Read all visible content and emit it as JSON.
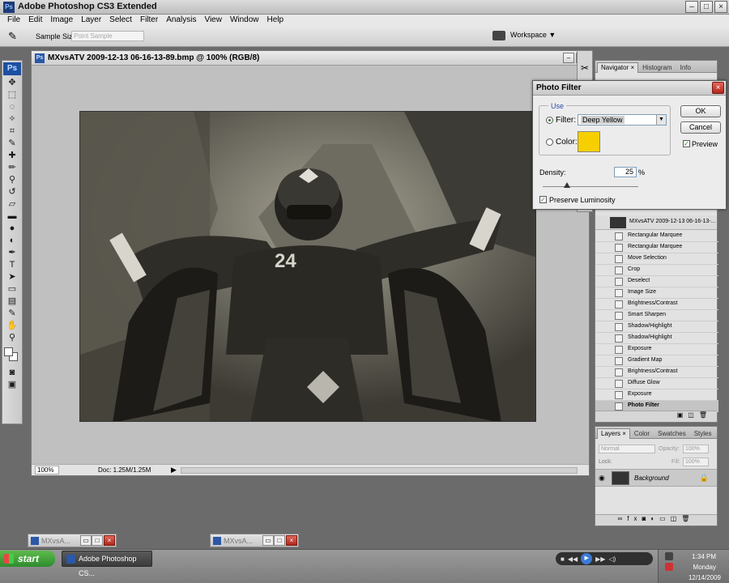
{
  "app": {
    "title": "Adobe Photoshop CS3 Extended",
    "logo": "Ps"
  },
  "menu": [
    "File",
    "Edit",
    "Image",
    "Layer",
    "Select",
    "Filter",
    "Analysis",
    "View",
    "Window",
    "Help"
  ],
  "options": {
    "sample_size_label": "Sample Size:",
    "sample_size_value": "Point Sample",
    "workspace_label": "Workspace ▼"
  },
  "document": {
    "title": "MXvsATV 2009-12-13 06-16-13-89.bmp @ 100% (RGB/8)",
    "zoom": "100%",
    "doc_info": "Doc: 1.25M/1.25M"
  },
  "dialog": {
    "title": "Photo Filter",
    "use_label": "Use",
    "filter_label": "Filter:",
    "filter_value": "Deep Yellow",
    "color_label": "Color:",
    "swatch_color": "#f7cf00",
    "ok": "OK",
    "cancel": "Cancel",
    "preview": "Preview",
    "density_label": "Density:",
    "density_value": "25",
    "density_unit": "%",
    "density_fraction": 0.25,
    "preserve": "Preserve Luminosity"
  },
  "top_panel": {
    "tabs": [
      "Navigator ×",
      "Histogram",
      "Info"
    ]
  },
  "history": {
    "snapshot": "MXvsATV 2009-12-13 06-16-13-...",
    "items": [
      "Rectangular Marquee",
      "Rectangular Marquee",
      "Move Selection",
      "Crop",
      "Deselect",
      "Image Size",
      "Brightness/Contrast",
      "Smart Sharpen",
      "Shadow/Highlight",
      "Shadow/Highlight",
      "Exposure",
      "Gradient Map",
      "Brightness/Contrast",
      "Diffuse Glow",
      "Exposure",
      "Photo Filter"
    ]
  },
  "layers": {
    "tabs": [
      "Layers ×",
      "Color",
      "Swatches",
      "Styles"
    ],
    "mode": "Normal",
    "opacity_label": "Opacity:",
    "opacity": "100%",
    "lock_label": "Lock:",
    "fill_label": "Fill:",
    "fill": "100%",
    "layer_name": "Background"
  },
  "minimized": [
    "MXvsA...",
    "MXvsA..."
  ],
  "taskbar": {
    "start": "start",
    "task": "Adobe Photoshop CS...",
    "time": "1:34 PM",
    "day": "Monday",
    "date": "12/14/2009"
  }
}
